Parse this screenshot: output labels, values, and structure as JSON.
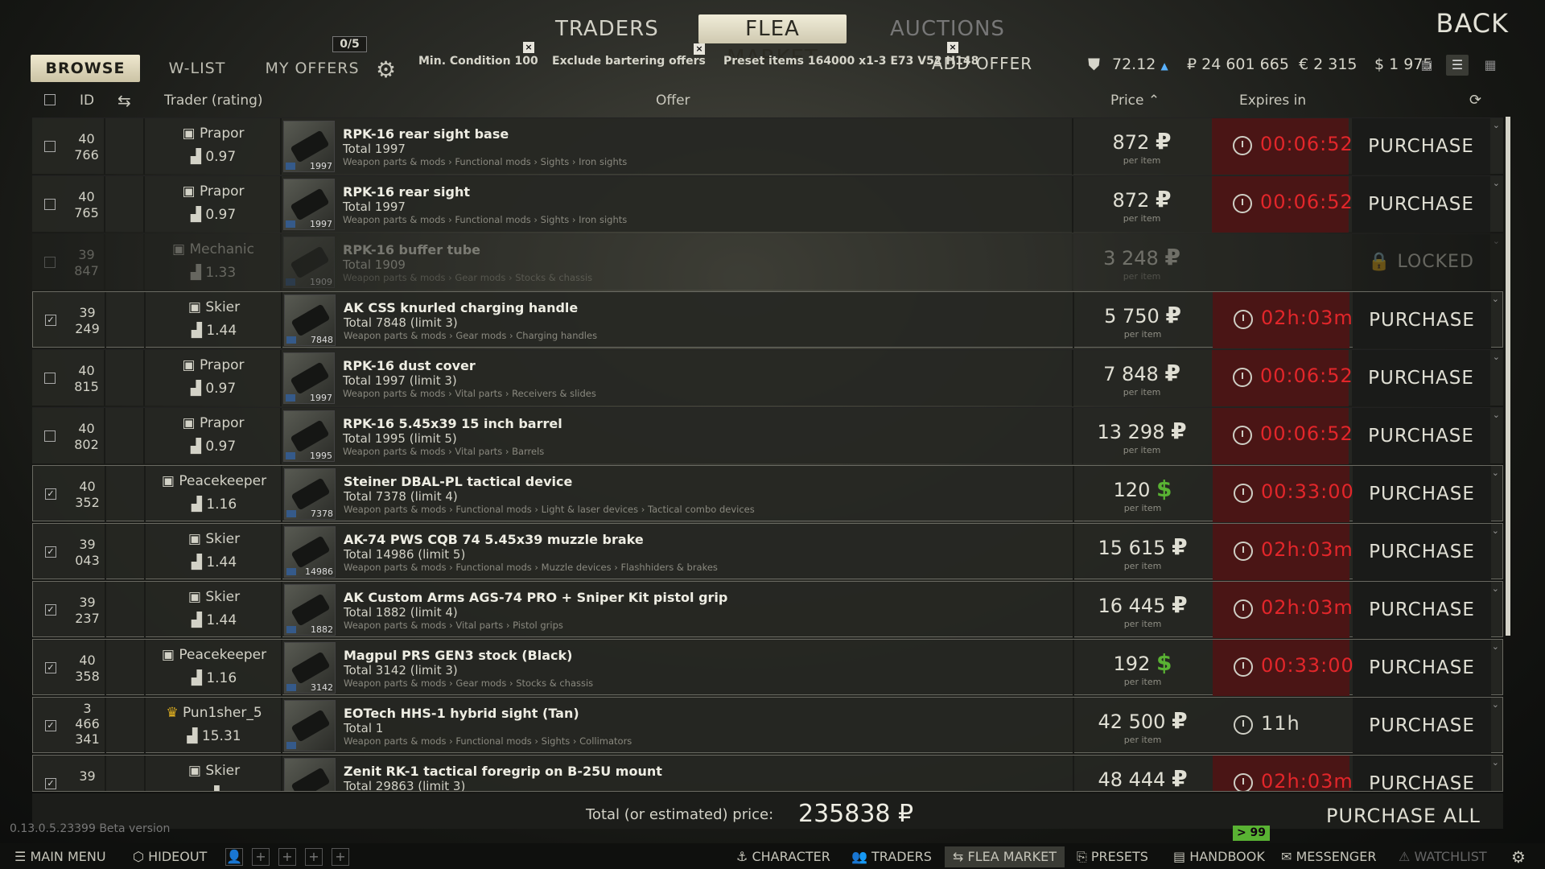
{
  "nav": {
    "traders": "TRADERS",
    "flea_market": "FLEA MARKET",
    "auctions": "AUCTIONS",
    "back": "BACK"
  },
  "tabs": {
    "browse": "BROWSE",
    "wlist": "W-LIST",
    "my_offers": "MY OFFERS",
    "offers_badge": "0/5",
    "add_offer": "ADD OFFER"
  },
  "filters": {
    "min_condition": "Min. Condition 100",
    "exclude_bartering": "Exclude bartering offers",
    "preset_items": "Preset items 164000 x1-3 E73 V52 H148"
  },
  "currencies": {
    "rating": "72.12",
    "rub": "₽ 24 601 665",
    "eur": "€ 2 315",
    "usd": "$ 1 975"
  },
  "header": {
    "id": "ID",
    "trader": "Trader (rating)",
    "offer": "Offer",
    "price": "Price ⌃",
    "expires": "Expires in"
  },
  "rows": [
    {
      "id1": "40",
      "id2": "766",
      "trader": "Prapor",
      "rating": "0.97",
      "title": "RPK-16 rear sight base",
      "total": "Total 1997",
      "cat": "Weapon parts & mods › Functional mods › Sights › Iron sights",
      "count": "1997",
      "price": "872",
      "cur": "₽",
      "per": "per item",
      "expires": "00:06:52",
      "action": "PURCHASE"
    },
    {
      "id1": "40",
      "id2": "765",
      "trader": "Prapor",
      "rating": "0.97",
      "title": "RPK-16 rear sight",
      "total": "Total 1997",
      "cat": "Weapon parts & mods › Functional mods › Sights › Iron sights",
      "count": "1997",
      "price": "872",
      "cur": "₽",
      "per": "per item",
      "expires": "00:06:52",
      "action": "PURCHASE"
    },
    {
      "id1": "39",
      "id2": "847",
      "trader": "Mechanic",
      "rating": "1.33",
      "title": "RPK-16 buffer tube",
      "total": "Total 1909",
      "cat": "Weapon parts & mods › Gear mods › Stocks & chassis",
      "count": "1909",
      "price": "3 248",
      "cur": "₽",
      "per": "per item",
      "expires": "",
      "action": "LOCKED"
    },
    {
      "id1": "39",
      "id2": "249",
      "trader": "Skier",
      "rating": "1.44",
      "title": "AK CSS knurled charging handle",
      "total": "Total 7848  (limit 3)",
      "cat": "Weapon parts & mods › Gear mods › Charging handles",
      "count": "7848",
      "price": "5 750",
      "cur": "₽",
      "per": "per item",
      "expires": "02h:03m",
      "action": "PURCHASE"
    },
    {
      "id1": "40",
      "id2": "815",
      "trader": "Prapor",
      "rating": "0.97",
      "title": "RPK-16 dust cover",
      "total": "Total 1997  (limit 3)",
      "cat": "Weapon parts & mods › Vital parts › Receivers & slides",
      "count": "1997",
      "price": "7 848",
      "cur": "₽",
      "per": "per item",
      "expires": "00:06:52",
      "action": "PURCHASE"
    },
    {
      "id1": "40",
      "id2": "802",
      "trader": "Prapor",
      "rating": "0.97",
      "title": "RPK-16 5.45x39 15 inch barrel",
      "total": "Total 1995  (limit 5)",
      "cat": "Weapon parts & mods › Vital parts › Barrels",
      "count": "1995",
      "price": "13 298",
      "cur": "₽",
      "per": "per item",
      "expires": "00:06:52",
      "action": "PURCHASE"
    },
    {
      "id1": "40",
      "id2": "352",
      "trader": "Peacekeeper",
      "rating": "1.16",
      "title": "Steiner DBAL-PL tactical device",
      "total": "Total 7378  (limit 4)",
      "cat": "Weapon parts & mods › Functional mods › Light & laser devices › Tactical combo devices",
      "count": "7378",
      "price": "120",
      "cur": "$",
      "per": "per item",
      "expires": "00:33:00",
      "action": "PURCHASE"
    },
    {
      "id1": "39",
      "id2": "043",
      "trader": "Skier",
      "rating": "1.44",
      "title": "AK-74 PWS CQB 74 5.45x39 muzzle brake",
      "total": "Total 14986  (limit 5)",
      "cat": "Weapon parts & mods › Functional mods › Muzzle devices › Flashhiders & brakes",
      "count": "14986",
      "price": "15 615",
      "cur": "₽",
      "per": "per item",
      "expires": "02h:03m",
      "action": "PURCHASE"
    },
    {
      "id1": "39",
      "id2": "237",
      "trader": "Skier",
      "rating": "1.44",
      "title": "AK Custom Arms AGS-74 PRO + Sniper Kit pistol grip",
      "total": "Total 1882  (limit 4)",
      "cat": "Weapon parts & mods › Vital parts › Pistol grips",
      "count": "1882",
      "price": "16 445",
      "cur": "₽",
      "per": "per item",
      "expires": "02h:03m",
      "action": "PURCHASE"
    },
    {
      "id1": "40",
      "id2": "358",
      "trader": "Peacekeeper",
      "rating": "1.16",
      "title": "Magpul PRS GEN3 stock (Black)",
      "total": "Total 3142  (limit 3)",
      "cat": "Weapon parts & mods › Gear mods › Stocks & chassis",
      "count": "3142",
      "price": "192",
      "cur": "$",
      "per": "per item",
      "expires": "00:33:00",
      "action": "PURCHASE"
    },
    {
      "id1": "3",
      "id2": "466",
      "id3": "341",
      "trader": "Pun1sher_5",
      "rating": "15.31",
      "title": "EOTech HHS-1 hybrid sight (Tan)",
      "total": "Total 1",
      "cat": "Weapon parts & mods › Functional mods › Sights › Collimators",
      "count": "",
      "price": "42 500",
      "cur": "₽",
      "per": "per item",
      "expires": "11h",
      "action": "PURCHASE"
    },
    {
      "id1": "39",
      "id2": "",
      "trader": "Skier",
      "rating": "",
      "title": "Zenit RK-1 tactical foregrip on B-25U mount",
      "total": "Total 29863  (limit 3)",
      "cat": "",
      "count": "",
      "price": "48 444",
      "cur": "₽",
      "per": "",
      "expires": "02h:03m",
      "action": "PURCHASE"
    }
  ],
  "footer": {
    "total_label": "Total (or estimated) price:",
    "total_value": "235838 ₽",
    "purchase_all": "PURCHASE ALL",
    "badge": "> 99",
    "version": "0.13.0.5.23399 Beta version"
  },
  "taskbar": {
    "main_menu": "MAIN MENU",
    "hideout": "HIDEOUT",
    "character": "CHARACTER",
    "traders": "TRADERS",
    "flea_market": "FLEA MARKET",
    "presets": "PRESETS",
    "handbook": "HANDBOOK",
    "messenger": "MESSENGER",
    "watchlist": "WATCHLIST"
  },
  "colors": {
    "accent_red": "#e2262a",
    "usd_green": "#59b233",
    "active_tab": "#efe8cf"
  }
}
